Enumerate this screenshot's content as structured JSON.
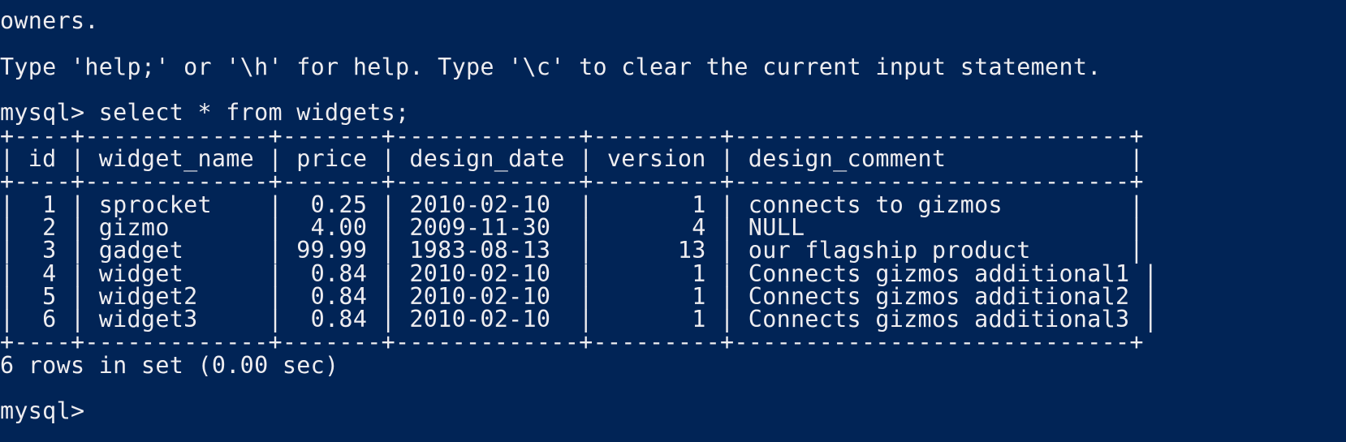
{
  "terminal": {
    "background": "#012456",
    "foreground": "#eeedf0",
    "lines": [
      "",
      "owners.",
      "",
      "Type 'help;' or '\\h' for help. Type '\\c' to clear the current input statement.",
      "",
      "mysql> select * from widgets;",
      "+----+-------------+-------+-------------+---------+----------------------------+",
      "| id | widget_name | price | design_date | version | design_comment             |",
      "+----+-------------+-------+-------------+---------+----------------------------+",
      "|  1 | sprocket    |  0.25 | 2010-02-10  |       1 | connects to gizmos         |",
      "|  2 | gizmo       |  4.00 | 2009-11-30  |       4 | NULL                       |",
      "|  3 | gadget      | 99.99 | 1983-08-13  |      13 | our flagship product       |",
      "|  4 | widget      |  0.84 | 2010-02-10  |       1 | Connects gizmos additional1 |",
      "|  5 | widget2     |  0.84 | 2010-02-10  |       1 | Connects gizmos additional2 |",
      "|  6 | widget3     |  0.84 | 2010-02-10  |       1 | Connects gizmos additional3 |",
      "+----+-------------+-------+-------------+---------+----------------------------+",
      "6 rows in set (0.00 sec)",
      "",
      "mysql> "
    ]
  },
  "query_result": {
    "columns": [
      "id",
      "widget_name",
      "price",
      "design_date",
      "version",
      "design_comment"
    ],
    "rows": [
      [
        "1",
        "sprocket",
        "0.25",
        "2010-02-10",
        "1",
        "connects to gizmos"
      ],
      [
        "2",
        "gizmo",
        "4.00",
        "2009-11-30",
        "4",
        "NULL"
      ],
      [
        "3",
        "gadget",
        "99.99",
        "1983-08-13",
        "13",
        "our flagship product"
      ],
      [
        "4",
        "widget",
        "0.84",
        "2010-02-10",
        "1",
        "Connects gizmos additional1"
      ],
      [
        "5",
        "widget2",
        "0.84",
        "2010-02-10",
        "1",
        "Connects gizmos additional2"
      ],
      [
        "6",
        "widget3",
        "0.84",
        "2010-02-10",
        "1",
        "Connects gizmos additional3"
      ]
    ]
  }
}
